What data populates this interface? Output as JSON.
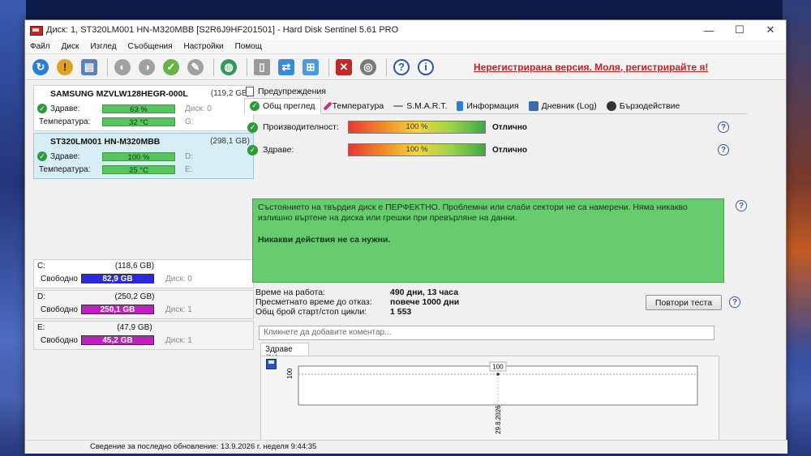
{
  "window": {
    "title": "Диск: 1, ST320LM001 HN-M320MBB [S2R6J9HF201501]  -  Hard Disk Sentinel 5.61 PRO",
    "minimize": "—",
    "maximize": "☐",
    "close": "✕"
  },
  "menu": [
    "Файл",
    "Диск",
    "Изглед",
    "Съобщения",
    "Настройки",
    "Помощ"
  ],
  "toolbar": {
    "unregistered": "Нерегистрирана версия. Моля, регистрирайте я!"
  },
  "disks": [
    {
      "name": "SAMSUNG MZVLW128HEGR-000L",
      "size": "(119,2 GB)",
      "health_label": "Здраве:",
      "health": "63 %",
      "health_pct": 63,
      "health_extra": "Диск: 0",
      "temp_label": "Температура:",
      "temp": "32 °C",
      "temp_extra": "G:"
    },
    {
      "name": "ST320LM001 HN-M320MBB",
      "size": "(298,1 GB)",
      "health_label": "Здраве:",
      "health": "100 %",
      "health_pct": 100,
      "health_extra": "D:",
      "temp_label": "Температура:",
      "temp": "25 °C",
      "temp_extra": "E:"
    }
  ],
  "volumes": [
    {
      "letter": "C:",
      "size": "(118,6 GB)",
      "free_label": "Свободно",
      "free": "82,9 GB",
      "disk": "Диск: 0",
      "color": "#2a2ae0"
    },
    {
      "letter": "D:",
      "size": "(250,2 GB)",
      "free_label": "Свободно",
      "free": "250,1 GB",
      "disk": "Диск: 1",
      "color": "#c020c0"
    },
    {
      "letter": "E:",
      "size": "(47,9 GB)",
      "free_label": "Свободно",
      "free": "45,2 GB",
      "disk": "Диск: 1",
      "color": "#c020c0"
    }
  ],
  "tabs": {
    "warnings": "Предупреждения",
    "overview": "Общ преглед",
    "temperature": "Температура",
    "smart": "S.M.A.R.T.",
    "info": "Информация",
    "log": "Дневник (Log)",
    "performance": "Бързодействие"
  },
  "overview": {
    "performance_label": "Производителност:",
    "performance_value": "100 %",
    "performance_text": "Отлично",
    "health_label": "Здраве:",
    "health_value": "100 %",
    "health_text": "Отлично",
    "status_line": "Състоянието на твърдия диск е ПЕРФЕКТНО. Проблемни или слаби сектори не са намерени. Няма никакво излишно въртене на диска или грешки при превърляне на данни.",
    "status_bold": "Никакви действия не са нужни.",
    "uptime_label": "Време на работа:",
    "uptime": "490 дни, 13 часа",
    "lifetime_label": "Пресметнато време до отказ:",
    "lifetime": "повече 1000 дни",
    "cycles_label": "Общ брой старт/стоп цикли:",
    "cycles": "1 553",
    "retest": "Повтори теста",
    "comment_placeholder": "Кликнете да добавите коментар...",
    "chart_tab": "Здраве (%)"
  },
  "chart_data": {
    "type": "line",
    "x": [
      "29.8.2026"
    ],
    "values": [
      100
    ],
    "ylabel": "100",
    "point_label": "100"
  },
  "statusbar": "Сведение за последно обновление: 13.9.2026 г. неделя 9:44:35"
}
